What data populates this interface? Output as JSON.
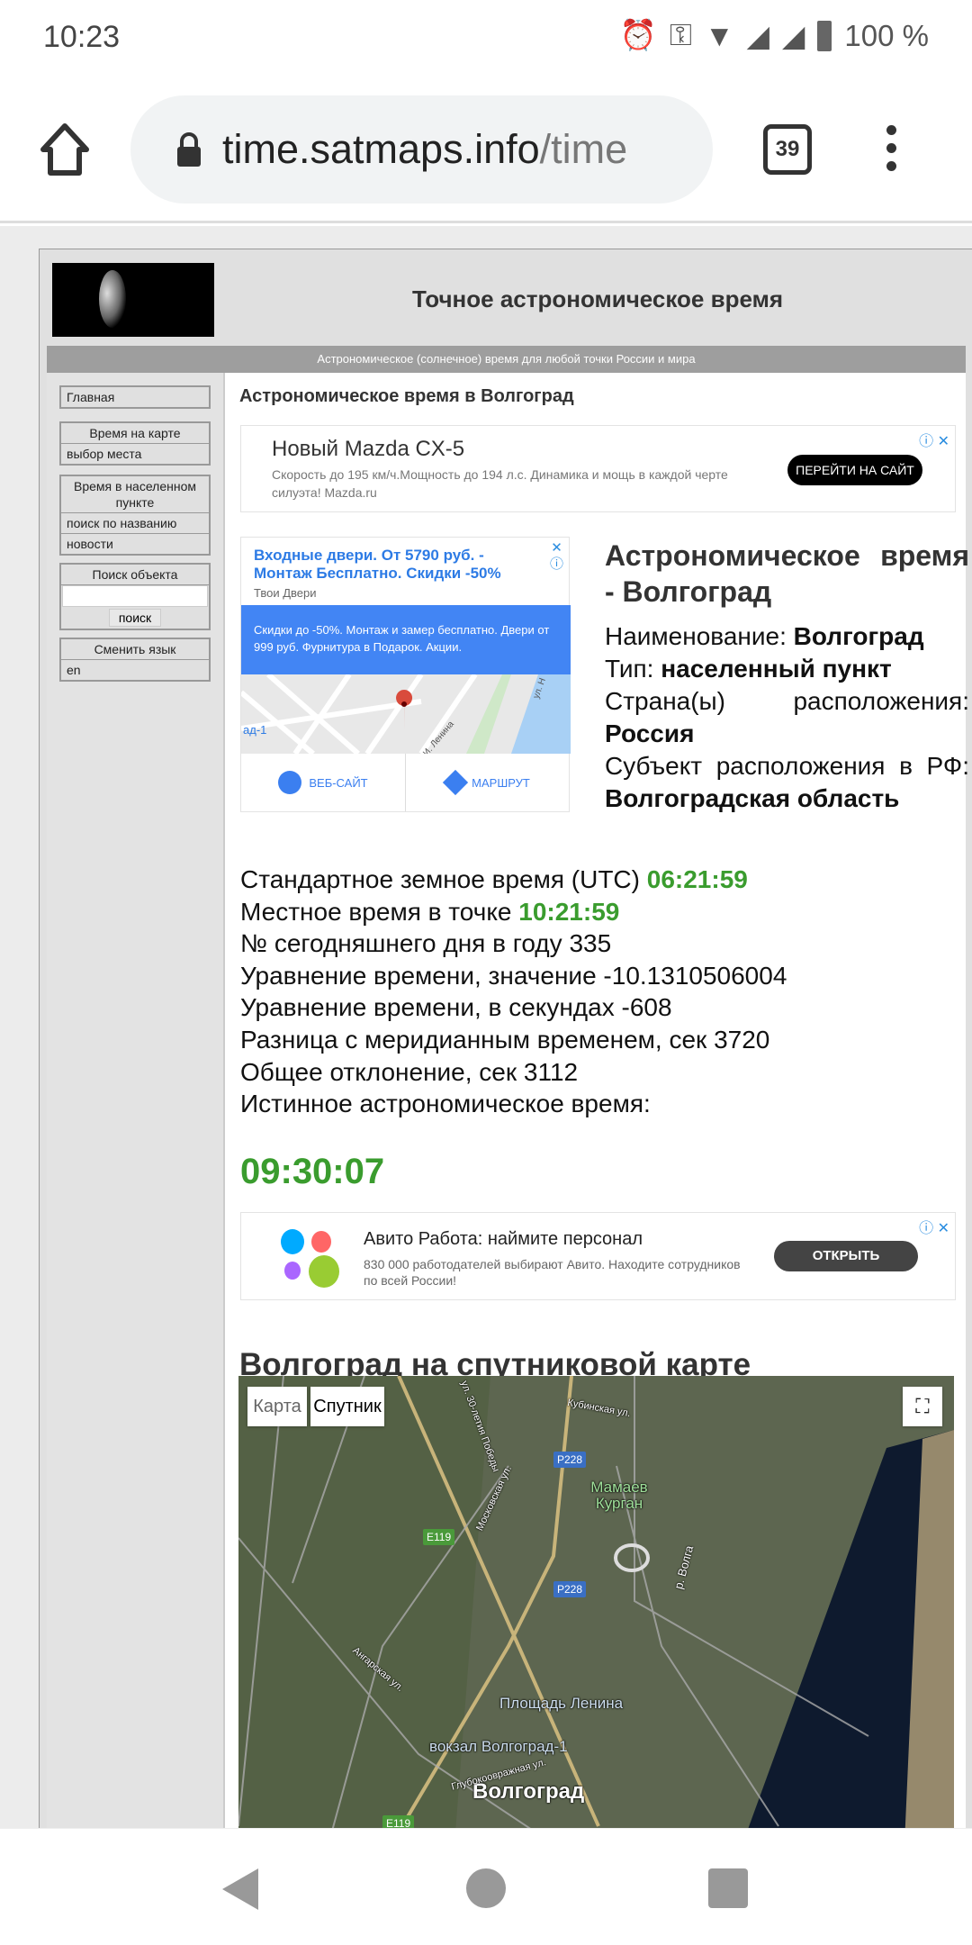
{
  "status_bar": {
    "time": "10:23",
    "battery": "100 %",
    "icons": [
      "alarm-icon",
      "vpn-key-icon",
      "wifi-icon",
      "signal-icon",
      "signal-icon",
      "battery-icon"
    ]
  },
  "browser": {
    "url_host": "time.satmaps.info",
    "url_path": "/time",
    "tab_count": "39"
  },
  "header": {
    "title": "Точное астрономическое время",
    "tagline": "Астрономическое (солнечное) время для любой точки России и мира"
  },
  "sidebar": {
    "home": "Главная",
    "map_section": {
      "title": "Время на карте",
      "items": [
        "выбор места"
      ]
    },
    "place_section": {
      "title": "Время в населенном пункте",
      "items": [
        "поиск по названию",
        "новости"
      ]
    },
    "search": {
      "title": "Поиск объекта",
      "value": "",
      "button": "поиск"
    },
    "lang": {
      "title": "Сменить язык",
      "items": [
        "en"
      ]
    }
  },
  "main": {
    "heading": "Астрономическое время в Волгоград",
    "ad_mazda": {
      "title": "Новый Mazda CX-5",
      "text": "Скорость до 195 км/ч.Мощность до 194 л.с. Динамика и мощь в каждой черте силуэта! Mazda.ru",
      "button": "ПЕРЕЙТИ НА САЙТ"
    },
    "ad_doors": {
      "title": "Входные двери. От 5790 руб. - Монтаж Бесплатно. Скидки -50%",
      "advertiser": "Твои Двери",
      "text": "Скидки до -50%. Монтаж и замер бесплатно. Двери от 999 руб. Фурнитура в Подарок. Акции.",
      "map_labels": [
        "ад-1",
        "ул. Н",
        "И. Ленина"
      ],
      "website": "ВЕБ-САЙТ",
      "route": "МАРШРУТ"
    },
    "place": {
      "title": "Астрономическое время - Волгоград",
      "name_label": "Наименование:",
      "name": "Волгоград",
      "type_label": "Тип:",
      "type": "населенный пункт",
      "country_label": "Страна(ы) расположения:",
      "country": "Россия",
      "region_label": "Субъект расположения в РФ:",
      "region": "Волгоградская область"
    },
    "times": {
      "utc_label": "Стандартное земное время (UTC)",
      "utc": "06:21:59",
      "local_label": "Местное время в точке",
      "local": "10:21:59",
      "day_label": "№ сегодняшнего дня в году",
      "day": "335",
      "eot_label": "Уравнение времени, значение",
      "eot": "-10.1310506004",
      "eot_sec_label": "Уравнение времени, в секундах",
      "eot_sec": "-608",
      "meridian_label": "Разница с меридианным временем, сек",
      "meridian": "3720",
      "total_label": "Общее отклонение, сек",
      "total": "3112",
      "true_label": "Истинное астрономическое время:",
      "true_time": "09:30:07"
    },
    "ad_avito": {
      "title": "Авито Работа: наймите персонал",
      "text": "830 000 работодателей выбирают Авито. Находите сотрудников по всей России!",
      "button": "ОТКРЫТЬ"
    },
    "map_heading": "Волгоград на спутниковой карте",
    "map": {
      "btn_map": "Карта",
      "btn_sat": "Спутник",
      "labels": {
        "city": "Волгоград",
        "kurgan": "Мамаев Курган",
        "square": "Площадь Ленина",
        "station": "вокзал Волгоград-1",
        "river": "р. Волга",
        "street1": "Ангарская ул.",
        "street2": "Московская ул.",
        "street3": "Кубинская ул.",
        "street4": "ул. 30-летия Победы",
        "street5": "Глубокоовражная ул."
      },
      "shields": [
        "P228",
        "P228",
        "E119",
        "E119"
      ]
    }
  },
  "colors": {
    "accent_green": "#3a9c2e",
    "ad_blue": "#4285f4"
  }
}
